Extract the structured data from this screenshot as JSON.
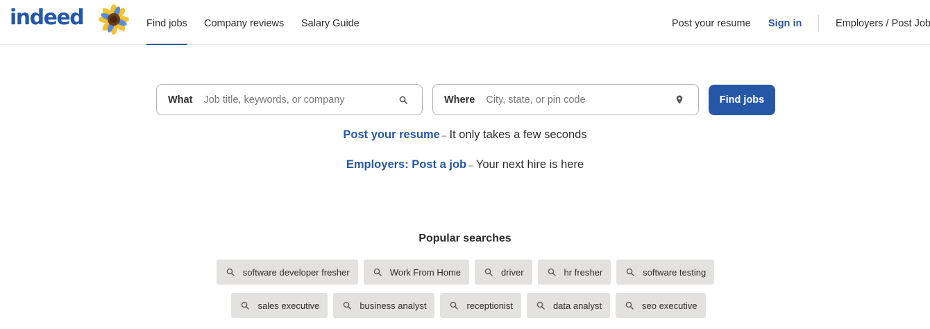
{
  "header": {
    "logo_text": "indeed",
    "nav": {
      "find_jobs": "Find jobs",
      "company_reviews": "Company reviews",
      "salary_guide": "Salary Guide",
      "post_resume": "Post your resume",
      "sign_in": "Sign in",
      "employers": "Employers / Post Job"
    }
  },
  "search": {
    "what_label": "What",
    "what_placeholder": "Job title, keywords, or company",
    "what_value": "",
    "where_label": "Where",
    "where_placeholder": "City, state, or pin code",
    "where_value": "",
    "button_label": "Find jobs"
  },
  "promos": {
    "resume_link": "Post your resume",
    "resume_text": "It only takes a few seconds",
    "employer_link": "Employers: Post a job",
    "employer_text": "Your next hire is here",
    "separator": "–"
  },
  "popular": {
    "title": "Popular searches",
    "row1": [
      "software developer fresher",
      "Work From Home",
      "driver",
      "hr fresher",
      "software testing"
    ],
    "row2": [
      "sales executive",
      "business analyst",
      "receptionist",
      "data analyst",
      "seo executive"
    ]
  },
  "icons": {
    "search": "search-icon",
    "location": "location-pin-icon",
    "logo_flower": "sunflower-icon"
  },
  "colors": {
    "brand": "#2557a7",
    "chip_bg": "#e4e2e0",
    "text": "#2d2d2d"
  }
}
